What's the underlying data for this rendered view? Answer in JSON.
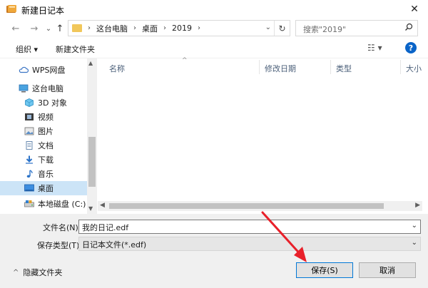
{
  "window": {
    "title": "新建日记本",
    "close_glyph": "✕"
  },
  "nav": {
    "back_glyph": "←",
    "forward_glyph": "→",
    "recent_glyph": "⌄",
    "up_glyph": "↑",
    "breadcrumbs": [
      "这台电脑",
      "桌面",
      "2019"
    ],
    "separator": "›",
    "address_dropdown_glyph": "⌄",
    "refresh_glyph": "↻"
  },
  "search": {
    "placeholder": "搜索\"2019\"",
    "icon": "search-icon"
  },
  "toolbar": {
    "organize_label": "组织 ▾",
    "new_folder_label": "新建文件夹",
    "view_glyph": "☷ ▾",
    "help_glyph": "?"
  },
  "sidebar": {
    "items": [
      {
        "label": "WPS网盘",
        "icon": "cloud-icon"
      },
      {
        "label": "这台电脑",
        "icon": "computer-icon"
      },
      {
        "label": "3D 对象",
        "icon": "cube-icon"
      },
      {
        "label": "视频",
        "icon": "video-icon"
      },
      {
        "label": "图片",
        "icon": "picture-icon"
      },
      {
        "label": "文档",
        "icon": "document-icon"
      },
      {
        "label": "下载",
        "icon": "download-icon"
      },
      {
        "label": "音乐",
        "icon": "music-icon"
      },
      {
        "label": "桌面",
        "icon": "desktop-icon",
        "selected": true
      },
      {
        "label": "本地磁盘 (C:)",
        "icon": "drive-icon"
      }
    ]
  },
  "filelist": {
    "columns": [
      "名称",
      "修改日期",
      "类型",
      "大小"
    ],
    "sort_glyph": "^"
  },
  "form": {
    "filename_label": "文件名(N):",
    "filename_value": "我的日记.edf",
    "filetype_label": "保存类型(T):",
    "filetype_value": "日记本文件(*.edf)"
  },
  "footer": {
    "hide_folders_label": "隐藏文件夹",
    "save_label": "保存(S)",
    "cancel_label": "取消"
  },
  "colors": {
    "accent": "#0078d7",
    "selection": "#cce4f7",
    "annotation_arrow": "#e8202a"
  }
}
